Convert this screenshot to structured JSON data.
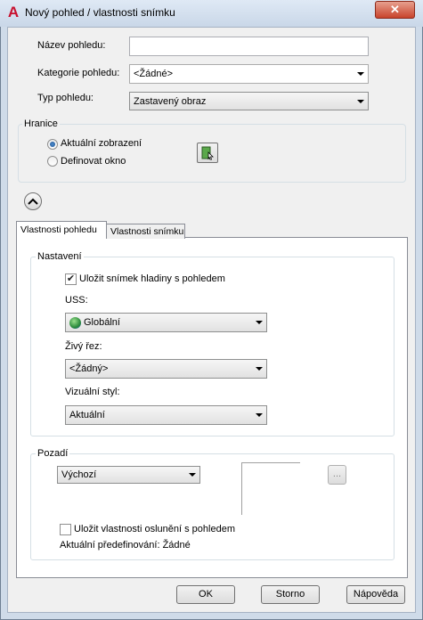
{
  "window": {
    "title": "Nový pohled / vlastnosti snímku",
    "close_glyph": "✕",
    "logo_glyph": "A"
  },
  "fields": {
    "name_label": "Název pohledu:",
    "name_value": "",
    "category_label": "Kategorie pohledu:",
    "category_value": "<Žádné>",
    "type_label": "Typ pohledu:",
    "type_value": "Zastavený obraz"
  },
  "boundary": {
    "title": "Hranice",
    "current_label": "Aktuální zobrazení",
    "define_label": "Definovat okno",
    "selected": "current"
  },
  "tabs": {
    "view_props": "Vlastnosti pohledu",
    "shot_props": "Vlastnosti snímku",
    "active": "view_props"
  },
  "settings": {
    "title": "Nastavení",
    "save_layer_label": "Uložit snímek hladiny s pohledem",
    "save_layer_checked": true,
    "ucs_label": "USS:",
    "ucs_value": "Globální",
    "live_section_label": "Živý řez:",
    "live_section_value": "<Žádný>",
    "visual_style_label": "Vizuální styl:",
    "visual_style_value": "Aktuální"
  },
  "background": {
    "title": "Pozadí",
    "type_value": "Výchozí",
    "browse_label": "...",
    "save_sun_label": "Uložit vlastnosti oslunění s pohledem",
    "save_sun_checked": false,
    "current_override": "Aktuální předefinování: Žádné"
  },
  "buttons": {
    "ok": "OK",
    "cancel": "Storno",
    "help": "Nápověda"
  },
  "colors": {
    "title_bar": "#cfdbe9",
    "close_red": "#c8432b",
    "logo_red": "#c8102e",
    "ucs_globe": "#2a8a3a"
  }
}
